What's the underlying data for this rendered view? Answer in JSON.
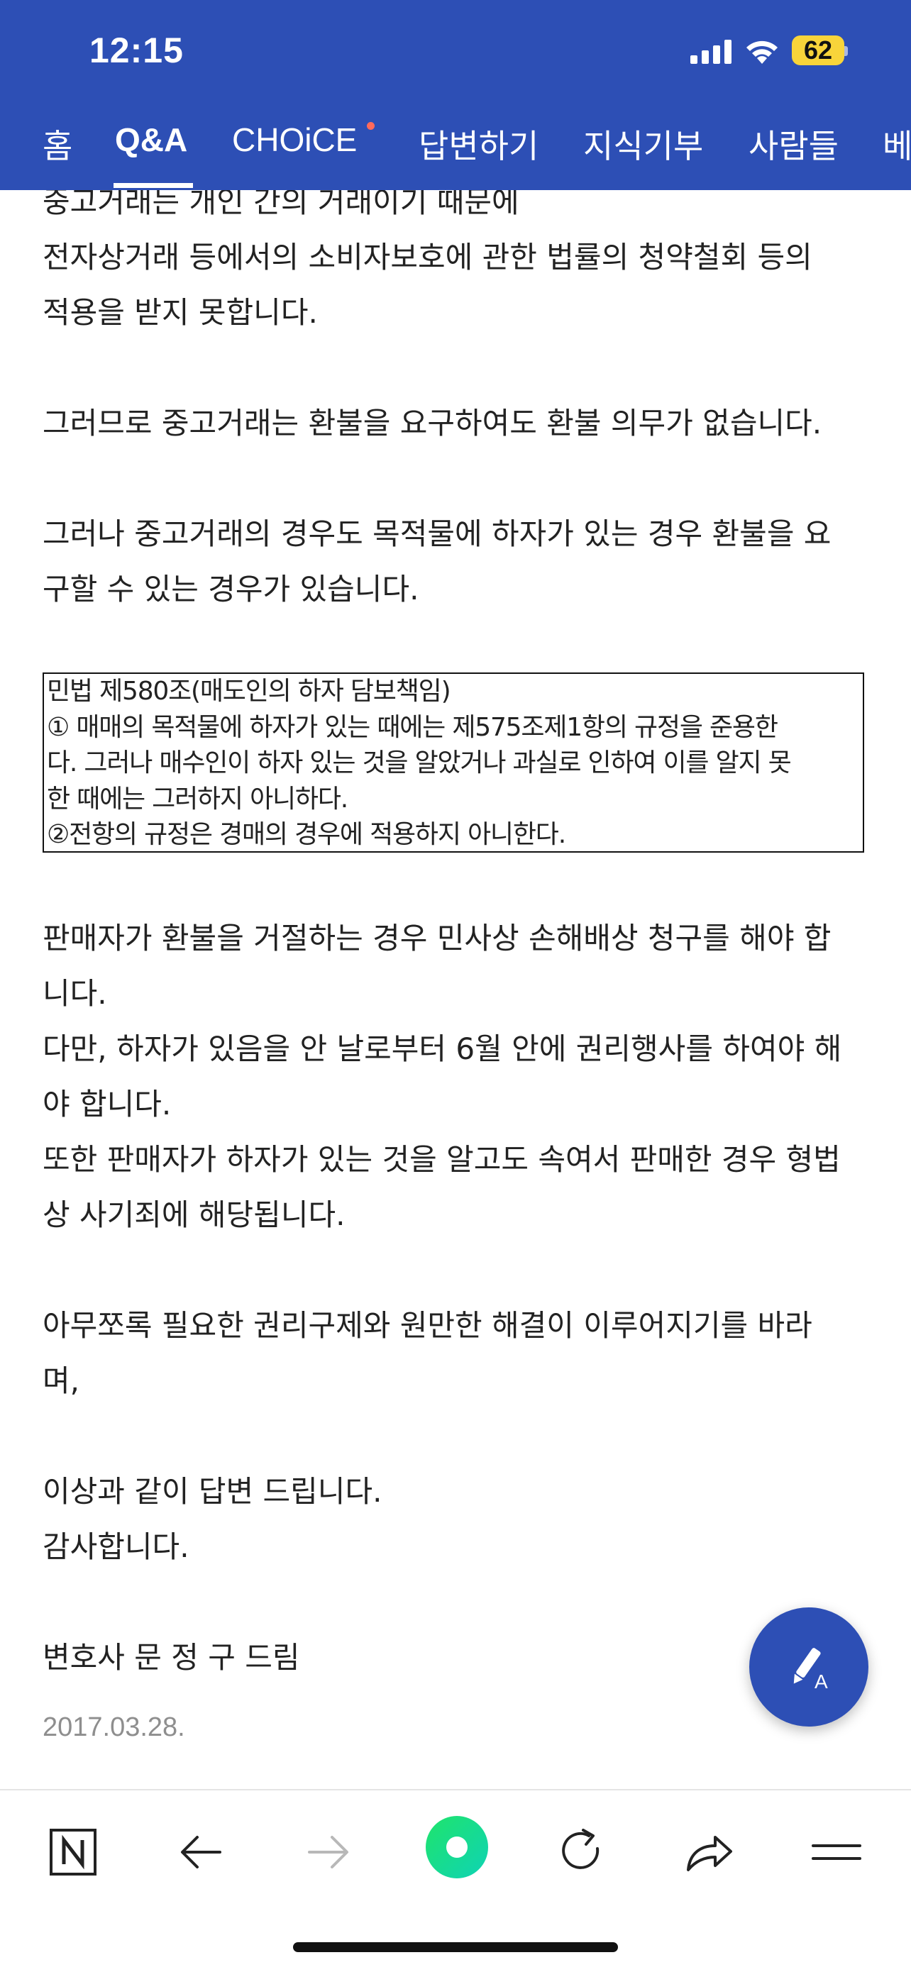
{
  "status_bar": {
    "time": "12:15",
    "battery": "62"
  },
  "tabs": [
    {
      "label": "홈"
    },
    {
      "label": "Q&A",
      "active": true
    },
    {
      "label": "CHOiCE",
      "has_new_dot": true
    },
    {
      "label": "답변하기"
    },
    {
      "label": "지식기부"
    },
    {
      "label": "사람들"
    },
    {
      "label": "베"
    }
  ],
  "answer": {
    "lines_top": [
      "중고거래는 개인 간의 거래이기 때문에",
      "전자상거래 등에서의 소비자보호에 관한 법률의 청약철회 등의",
      "적용을 받지 못합니다.",
      "",
      "그러므로 중고거래는 환불을 요구하여도 환불 의무가 없습니다.",
      "",
      "그러나 중고거래의 경우도 목적물에 하자가 있는 경우 환불을 요",
      "구할 수 있는 경우가 있습니다."
    ],
    "law_box": [
      "민법 제580조(매도인의 하자 담보책임)",
      "① 매매의 목적물에 하자가 있는 때에는 제575조제1항의 규정을 준용한",
      "다. 그러나 매수인이 하자 있는 것을 알았거나 과실로 인하여 이를 알지 못",
      "한 때에는 그러하지 아니하다.",
      "②전항의 규정은 경매의 경우에 적용하지 아니한다."
    ],
    "lines_bottom": [
      "판매자가 환불을 거절하는 경우 민사상 손해배상 청구를 해야 합",
      "니다.",
      "다만, 하자가 있음을 안 날로부터 6월 안에 권리행사를 하여야 해",
      "야 합니다.",
      "또한 판매자가 하자가 있는 것을 알고도 속여서 판매한 경우 형법",
      "상 사기죄에 해당됩니다.",
      "",
      "아무쪼록 필요한 권리구제와 원만한 해결이 이루어지기를 바라",
      "며,",
      "",
      "이상과 같이 답변 드립니다.",
      "감사합니다.",
      "",
      "변호사 문 정 구 드림"
    ],
    "date": "2017.03.28."
  },
  "icons": {
    "fab": "write-answer-icon",
    "toolbar": [
      "naver-home-icon",
      "back-arrow-icon",
      "forward-arrow-icon",
      "green-dot-icon",
      "refresh-icon",
      "share-icon",
      "menu-icon"
    ]
  },
  "colors": {
    "header_bg": "#2d4fb5",
    "new_dot": "#ff6a5b",
    "battery": "#f8d43a",
    "green_button": "#1ed760"
  }
}
